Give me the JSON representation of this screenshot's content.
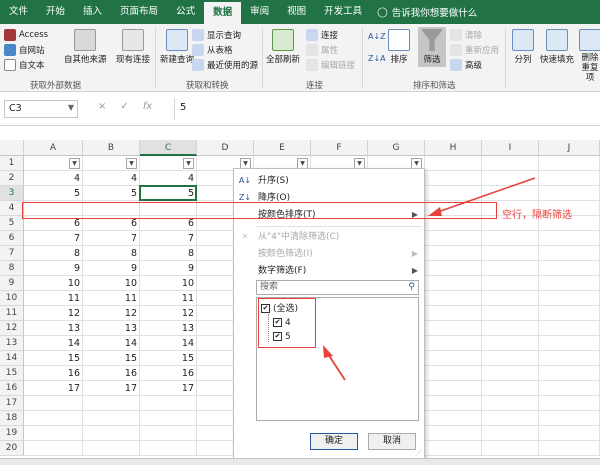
{
  "ribbon_tabs": [
    {
      "label": "文件",
      "active": false
    },
    {
      "label": "开始",
      "active": false
    },
    {
      "label": "插入",
      "active": false
    },
    {
      "label": "页面布局",
      "active": false
    },
    {
      "label": "公式",
      "active": false
    },
    {
      "label": "数据",
      "active": true
    },
    {
      "label": "审阅",
      "active": false
    },
    {
      "label": "视图",
      "active": false
    },
    {
      "label": "开发工具",
      "active": false
    }
  ],
  "tell_me": "告诉我你想要做什么",
  "ribbon": {
    "get_external": {
      "access": "Access",
      "web": "自网站",
      "text": "自文本",
      "other": "自其他来源",
      "existing": "现有连接",
      "group_label": "获取外部数据"
    },
    "transform": {
      "new_query": "新建查询",
      "show_queries": "显示查询",
      "from_table": "从表格",
      "recent_sources": "最近使用的源",
      "group_label": "获取和转换"
    },
    "connections": {
      "refresh_all": "全部刷新",
      "connections": "连接",
      "properties": "属性",
      "edit_links": "编辑链接",
      "group_label": "连接"
    },
    "sort_filter": {
      "sort": "排序",
      "filter": "筛选",
      "clear": "清除",
      "reapply": "重新应用",
      "advanced": "高级",
      "group_label": "排序和筛选"
    },
    "data_tools": {
      "split": "分列",
      "flash_fill": "快速填充",
      "remove_dup": "删除重复项"
    }
  },
  "formula_bar": {
    "name_box": "C3",
    "cancel": "×",
    "enter": "✓",
    "fx": "fx",
    "value": "5"
  },
  "columns": [
    "A",
    "B",
    "C",
    "D",
    "E",
    "F",
    "G",
    "H",
    "I",
    "J"
  ],
  "rows": [
    "1",
    "2",
    "3",
    "4",
    "5",
    "6",
    "7",
    "8",
    "9",
    "10",
    "11",
    "12",
    "13",
    "14",
    "15",
    "16",
    "17",
    "18",
    "19",
    "20"
  ],
  "cell_values": [
    [
      "",
      "",
      ""
    ],
    [
      "4",
      "4",
      "4"
    ],
    [
      "5",
      "5",
      "5"
    ],
    [
      "",
      "",
      ""
    ],
    [
      "6",
      "6",
      "6"
    ],
    [
      "7",
      "7",
      "7"
    ],
    [
      "8",
      "8",
      "8"
    ],
    [
      "9",
      "9",
      "9"
    ],
    [
      "10",
      "10",
      "10"
    ],
    [
      "11",
      "11",
      "11"
    ],
    [
      "12",
      "12",
      "12"
    ],
    [
      "13",
      "13",
      "13"
    ],
    [
      "14",
      "14",
      "14"
    ],
    [
      "15",
      "15",
      "15"
    ],
    [
      "16",
      "16",
      "16"
    ],
    [
      "17",
      "17",
      "17"
    ]
  ],
  "filter_menu": {
    "sort_asc": "升序(S)",
    "sort_desc": "降序(O)",
    "sort_by_color": "按颜色排序(T)",
    "clear_filter": "从\"4\"中清除筛选(C)",
    "filter_by_color": "按颜色筛选(I)",
    "number_filters": "数字筛选(F)",
    "search_placeholder": "搜索",
    "items": [
      {
        "label": "(全选)",
        "checked": true
      },
      {
        "label": "4",
        "checked": true
      },
      {
        "label": "5",
        "checked": true
      }
    ],
    "ok": "确定",
    "cancel": "取消"
  },
  "annotation": "空行，隔断筛选",
  "colors": {
    "excel_green": "#217346",
    "annotation_red": "#e8413a"
  }
}
